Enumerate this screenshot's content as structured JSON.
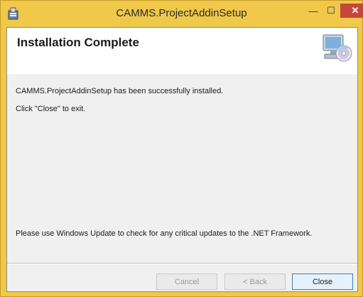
{
  "window": {
    "title": "CAMMS.ProjectAddinSetup",
    "controls": {
      "minimize": "—",
      "maximize": "☐",
      "close": "✕"
    }
  },
  "header": {
    "title": "Installation Complete",
    "graphic_icon": "computer-cd-icon"
  },
  "body": {
    "line1": "CAMMS.ProjectAddinSetup has been successfully installed.",
    "line2": "Click \"Close\" to exit.",
    "line3": "Please use Windows Update to check for any critical updates to the .NET Framework."
  },
  "buttons": {
    "cancel": "Cancel",
    "back": "< Back",
    "close": "Close"
  },
  "colors": {
    "titlebar": "#f0c84a",
    "close_button": "#c7463b",
    "default_button_border": "#3c7fb1"
  }
}
